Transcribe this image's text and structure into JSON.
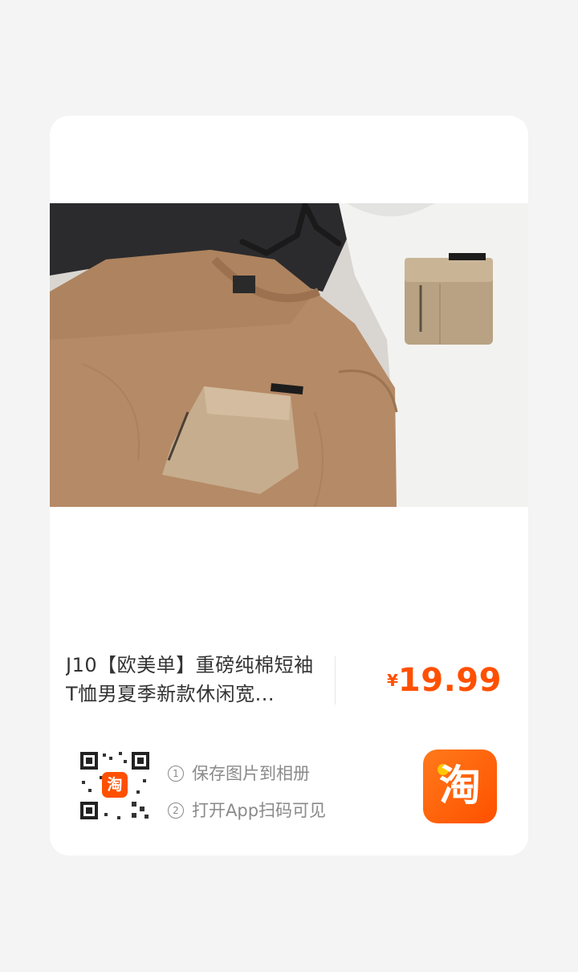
{
  "product": {
    "title": "J10【欧美单】重磅纯棉短袖T恤男夏季新款休闲宽...",
    "image_alt": "Three t-shirts (tan, black, white) with utility chest pockets on hangers",
    "price_symbol": "¥",
    "price_value": "19.99"
  },
  "share": {
    "step1_number": "1",
    "step1_text": "保存图片到相册",
    "step2_number": "2",
    "step2_text": "打开App扫码可见"
  },
  "app_logo": {
    "name": "taobao-logo",
    "glyph": "淘"
  },
  "qr_badge_glyph": "淘",
  "colors": {
    "accent": "#ff5000",
    "page_bg": "#f4f4f4",
    "card_bg": "#ffffff",
    "muted_text": "#8a8a8a",
    "title_text": "#333333"
  }
}
